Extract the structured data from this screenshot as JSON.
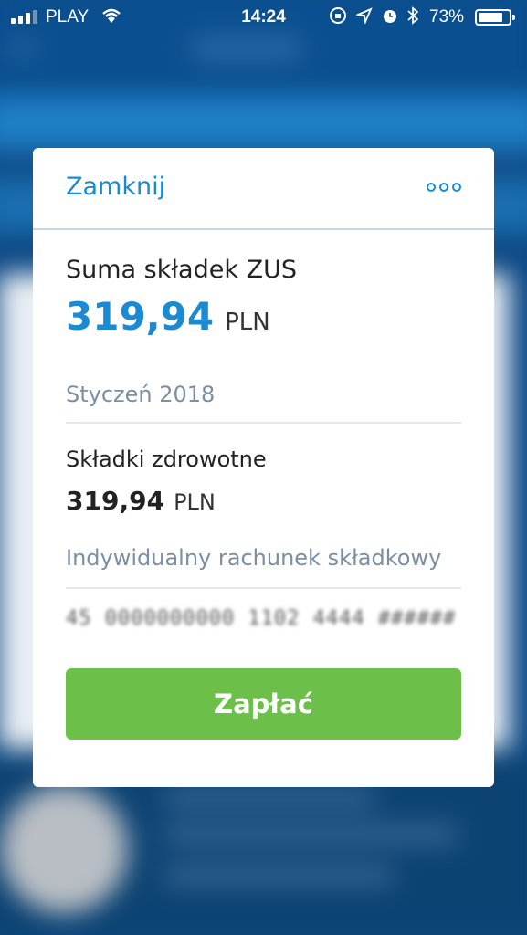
{
  "status_bar": {
    "carrier": "PLAY",
    "time": "14:24",
    "battery": "73%"
  },
  "modal": {
    "close_label": "Zamknij",
    "more_icon": "more-options-icon",
    "sum_label": "Suma składek ZUS",
    "sum_value": "319,94",
    "sum_currency": "PLN",
    "month": "Styczeń 2018",
    "health_label": "Składki zdrowotne",
    "health_value": "319,94",
    "health_currency": "PLN",
    "account_label": "Indywidualny rachunek składkowy",
    "account_number": "45 0000000000 1102 4444 ######",
    "pay_label": "Zapłać"
  },
  "colors": {
    "accent": "#1a8ad3",
    "pay_button": "#6cc04a",
    "muted_text": "#7b8fa3"
  }
}
